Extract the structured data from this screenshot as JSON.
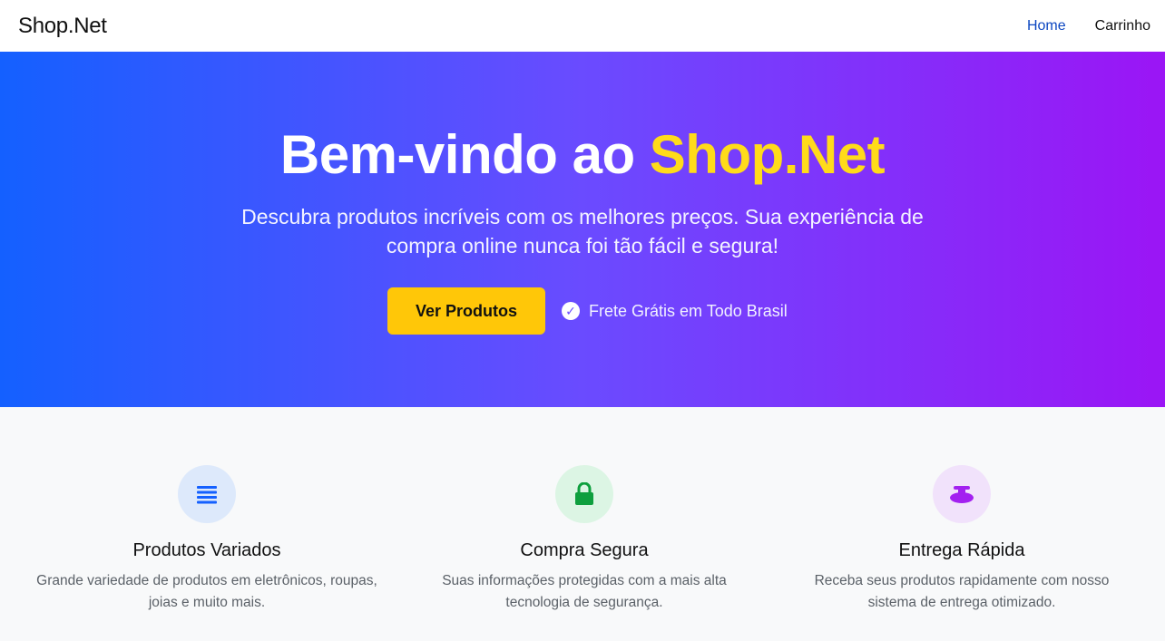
{
  "navbar": {
    "brand": "Shop.Net",
    "links": [
      {
        "label": "Home",
        "active": true
      },
      {
        "label": "Carrinho",
        "active": false
      }
    ]
  },
  "hero": {
    "title_prefix": "Bem-vindo ao ",
    "title_accent": "Shop.Net",
    "subtitle": "Descubra produtos incríveis com os melhores preços. Sua experiência de compra online nunca foi tão fácil e segura!",
    "cta_label": "Ver Produtos",
    "shipping_text": "Frete Grátis em Todo Brasil",
    "colors": {
      "gradient_start": "#1460ff",
      "gradient_end": "#9b15f5",
      "accent": "#ffdb1a",
      "cta": "#ffc708"
    }
  },
  "features": [
    {
      "icon": "list-icon",
      "title": "Produtos Variados",
      "description": "Grande variedade de produtos em eletrônicos, roupas, joias e muito mais.",
      "icon_color": "#1460ff",
      "icon_bg": "#dde9fb"
    },
    {
      "icon": "lock-icon",
      "title": "Compra Segura",
      "description": "Suas informações protegidas com a mais alta tecnologia de segurança.",
      "icon_color": "#0e9f3e",
      "icon_bg": "#dcf5e4"
    },
    {
      "icon": "delivery-icon",
      "title": "Entrega Rápida",
      "description": "Receba seus produtos rapidamente com nosso sistema de entrega otimizado.",
      "icon_color": "#a321f0",
      "icon_bg": "#f1e2fb"
    }
  ]
}
